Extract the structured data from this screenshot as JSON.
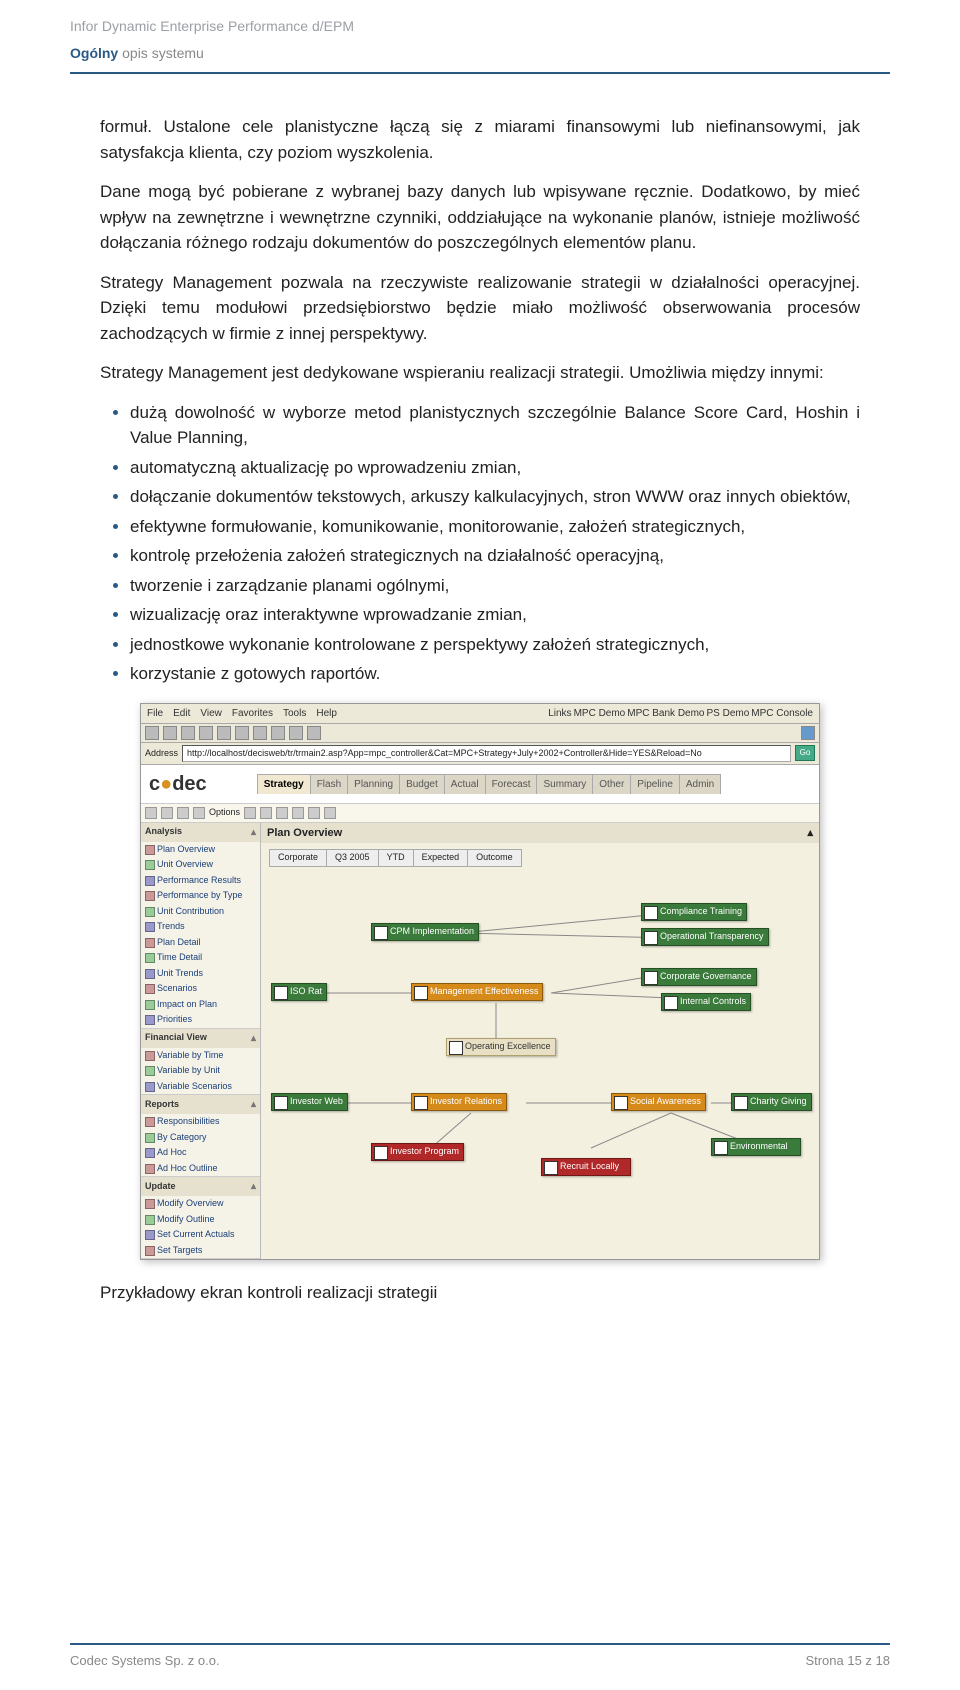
{
  "header": {
    "line1": "Infor Dynamic Enterprise Performance d/EPM",
    "line2_bold": "Ogólny",
    "line2_rest": " opis systemu"
  },
  "body": {
    "p1": "formuł. Ustalone cele planistyczne łączą się z miarami finansowymi lub niefinansowymi, jak satysfakcja klienta, czy poziom wyszkolenia.",
    "p2": "Dane mogą być pobierane z wybranej bazy danych lub wpisywane ręcznie. Dodatkowo, by mieć wpływ na zewnętrzne i wewnętrzne czynniki, oddziałujące na wykonanie planów, istnieje możliwość dołączania różnego rodzaju dokumentów do poszczególnych elementów planu.",
    "p3": "Strategy Management pozwala na rzeczywiste realizowanie strategii w działalności operacyjnej. Dzięki temu modułowi przedsiębiorstwo będzie miało możliwość obserwowania procesów zachodzących w firmie z innej perspektywy.",
    "p4": "Strategy Management jest dedykowane wspieraniu realizacji strategii. Umożliwia między innymi:",
    "bullets": [
      "dużą dowolność w wyborze metod planistycznych szczególnie Balance Score Card, Hoshin i Value Planning,",
      "automatyczną aktualizację po wprowadzeniu zmian,",
      "dołączanie dokumentów tekstowych, arkuszy kalkulacyjnych, stron WWW oraz innych obiektów,",
      "efektywne formułowanie, komunikowanie, monitorowanie, założeń strategicznych,",
      "kontrolę przełożenia założeń strategicznych na działalność operacyjną,",
      "tworzenie i zarządzanie planami ogólnymi,",
      "wizualizację oraz interaktywne wprowadzanie zmian,",
      "jednostkowe wykonanie kontrolowane z perspektywy założeń strategicznych,",
      "korzystanie z gotowych raportów."
    ],
    "caption": "Przykładowy ekran kontroli realizacji strategii"
  },
  "screenshot": {
    "menubar": [
      "File",
      "Edit",
      "View",
      "Favorites",
      "Tools",
      "Help"
    ],
    "links": [
      "Links",
      "MPC Demo",
      "MPC Bank Demo",
      "PS Demo",
      "MPC Console"
    ],
    "address_label": "Address",
    "address_url": "http://localhost/decisweb/tr/trmain2.asp?App=mpc_controller&Cat=MPC+Strategy+July+2002+Controller&Hide=YES&Reload=No",
    "go": "Go",
    "logo": "codec",
    "main_tabs": [
      "Strategy",
      "Flash",
      "Planning",
      "Budget",
      "Actual",
      "Forecast",
      "Summary",
      "Other",
      "Pipeline",
      "Admin"
    ],
    "sub_options": "Options",
    "canvas_title": "Plan Overview",
    "filter_tabs": [
      "Corporate",
      "Q3 2005",
      "YTD",
      "Expected",
      "Outcome"
    ],
    "sidebar": [
      {
        "title": "Analysis",
        "items": [
          "Plan Overview",
          "Unit Overview",
          "Performance Results",
          "Performance by Type",
          "Unit Contribution",
          "Trends",
          "Plan Detail",
          "Time Detail",
          "Unit Trends",
          "Scenarios",
          "Impact on Plan",
          "Priorities"
        ]
      },
      {
        "title": "Financial View",
        "items": [
          "Variable by Time",
          "Variable by Unit",
          "Variable Scenarios"
        ]
      },
      {
        "title": "Reports",
        "items": [
          "Responsibilities",
          "By Category",
          "Ad Hoc",
          "Ad Hoc Outline"
        ]
      },
      {
        "title": "Update",
        "items": [
          "Modify Overview",
          "Modify Outline",
          "Set Current Actuals",
          "Set Targets"
        ]
      }
    ],
    "nodes": {
      "cpm": "CPM Implementation",
      "compliance": "Compliance Training",
      "op_trans": "Operational Transparency",
      "iso": "ISO Rat",
      "mgmt_eff": "Management Effectiveness",
      "corp_gov": "Corporate Governance",
      "int_ctrl": "Internal Controls",
      "op_exc": "Operating Excellence",
      "inv_web": "Investor Web",
      "inv_rel": "Investor Relations",
      "soc_aware": "Social Awareness",
      "charity": "Charity Giving",
      "inv_prog": "Investor Program",
      "recruit": "Recruit Locally",
      "env": "Environmental"
    }
  },
  "footer": {
    "left": "Codec Systems  Sp. z o.o.",
    "right": "Strona 15 z 18"
  }
}
